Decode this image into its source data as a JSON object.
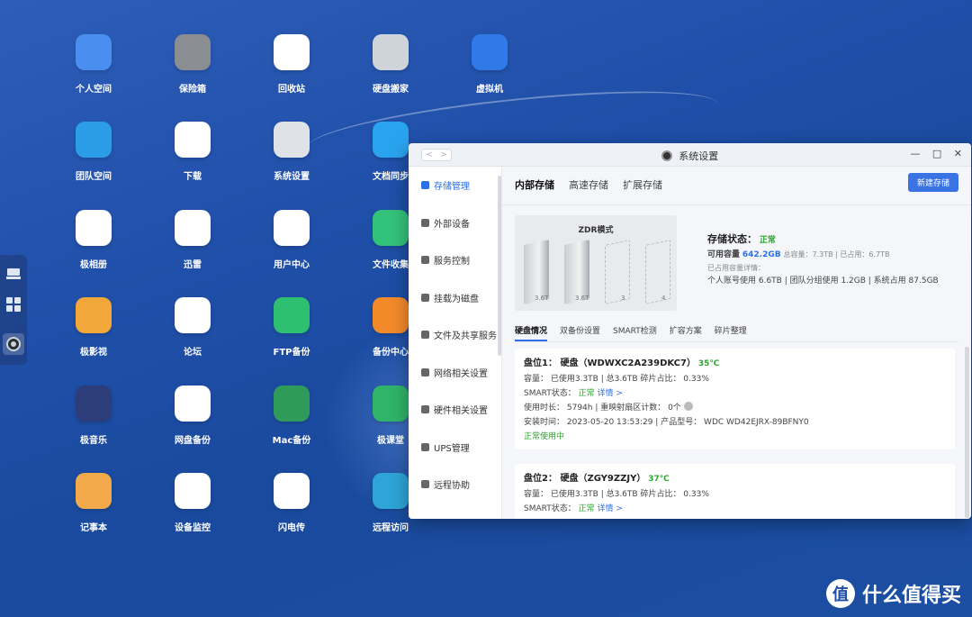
{
  "desktop": {
    "apps": [
      {
        "label": "个人空间",
        "icon": "folder-icon",
        "color": "#4a8ff0"
      },
      {
        "label": "保险箱",
        "icon": "safe-icon",
        "color": "#8a8d92"
      },
      {
        "label": "回收站",
        "icon": "trash-icon",
        "color": "#ffffff"
      },
      {
        "label": "硬盘搬家",
        "icon": "disk-move-icon",
        "color": "#cfd4da"
      },
      {
        "label": "虚拟机",
        "icon": "virtual-machine-icon",
        "color": "#2f79e8"
      },
      {
        "label": "团队空间",
        "icon": "team-folder-icon",
        "color": "#2a9de6"
      },
      {
        "label": "下载",
        "icon": "download-globe-icon",
        "color": "#ffffff"
      },
      {
        "label": "系统设置",
        "icon": "settings-icon",
        "color": "#dfe3e8"
      },
      {
        "label": "文档同步",
        "icon": "doc-sync-icon",
        "color": "#2aa3ee"
      },
      {
        "label": "极相册",
        "icon": "photos-icon",
        "color": "#ffffff"
      },
      {
        "label": "迅雷",
        "icon": "xunlei-icon",
        "color": "#ffffff"
      },
      {
        "label": "用户中心",
        "icon": "user-icon",
        "color": "#ffffff"
      },
      {
        "label": "文件收集",
        "icon": "file-collect-icon",
        "color": "#33c27a"
      },
      {
        "label": "极影视",
        "icon": "video-icon",
        "color": "#f1a73a"
      },
      {
        "label": "论坛",
        "icon": "forum-icon",
        "color": "#ffffff"
      },
      {
        "label": "FTP备份",
        "icon": "ftp-icon",
        "color": "#2fbf71"
      },
      {
        "label": "备份中心",
        "icon": "backup-center-icon",
        "color": "#f28a2a"
      },
      {
        "label": "极音乐",
        "icon": "music-icon",
        "color": "#2c3d7a"
      },
      {
        "label": "网盘备份",
        "icon": "cloud-backup-icon",
        "color": "#ffffff"
      },
      {
        "label": "Mac备份",
        "icon": "time-machine-icon",
        "color": "#2f9a5a"
      },
      {
        "label": "极课堂",
        "icon": "classroom-icon",
        "color": "#2fb46a"
      },
      {
        "label": "记事本",
        "icon": "notepad-icon",
        "color": "#f2a94a"
      },
      {
        "label": "设备监控",
        "icon": "monitor-icon",
        "color": "#ffffff"
      },
      {
        "label": "闪电传",
        "icon": "flash-transfer-icon",
        "color": "#ffffff"
      },
      {
        "label": "远程访问",
        "icon": "remote-access-icon",
        "color": "#2ea5d6"
      }
    ]
  },
  "dock": [
    "nas-icon",
    "apps-grid-icon",
    "settings-icon"
  ],
  "window": {
    "title": "系统设置",
    "sidebar": [
      "存储管理",
      "外部设备",
      "服务控制",
      "挂载为磁盘",
      "文件及共享服务",
      "网络相关设置",
      "硬件相关设置",
      "UPS管理",
      "远程协助"
    ],
    "tabs": [
      "内部存储",
      "高速存储",
      "扩展存储"
    ],
    "new_storage_button": "新建存储",
    "zdr": {
      "title": "ZDR模式",
      "disks": [
        {
          "label": "3.6T",
          "present": true
        },
        {
          "label": "3.6T",
          "present": true
        },
        {
          "label": "3",
          "present": false
        },
        {
          "label": "4",
          "present": false
        }
      ]
    },
    "storage": {
      "status_label": "存储状态：",
      "status_value": "正常",
      "avail_label": "可用容量",
      "avail_value": "642.2GB",
      "total_text": "总容量：7.3TB | 已占用：6.7TB",
      "detail_label": "已占用容量详情：",
      "detail_text": "个人账号使用 6.6TB | 团队分组使用 1.2GB | 系统占用 87.5GB"
    },
    "subtabs": [
      "硬盘情况",
      "双备份设置",
      "SMART检测",
      "扩容方案",
      "碎片整理"
    ],
    "disk1": {
      "title": "盘位1：  硬盘（WDWXC2A239DKC7）",
      "temp": "35℃",
      "capacity": "容量：  已使用3.3TB | 总3.6TB     碎片占比：  0.33%",
      "smart_label": "SMART状态：",
      "smart_value": "正常",
      "smart_link": "详情 >",
      "usage": "使用时长：  5794h | 重映射扇区计数：  0个",
      "install": "安装时间：  2023-05-20 13:53:29 | 产品型号：  WDC WD42EJRX-89BFNY0",
      "state": "正常使用中"
    },
    "disk2": {
      "title": "盘位2：  硬盘（ZGY9ZZJY）",
      "temp": "37℃",
      "capacity": "容量：  已使用3.3TB | 总3.6TB     碎片占比：  0.33%",
      "smart_label": "SMART状态：",
      "smart_value": "正常",
      "smart_link": "详情 >"
    }
  },
  "watermark": {
    "logo": "值",
    "text": "什么值得买"
  }
}
